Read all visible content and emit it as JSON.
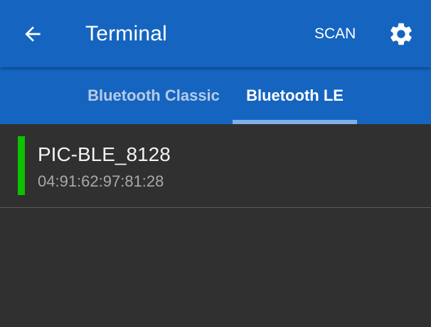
{
  "app_bar": {
    "back_icon": "arrow-back-icon",
    "title": "Terminal",
    "scan_label": "SCAN",
    "settings_icon": "gear-icon",
    "color": "#1565c0"
  },
  "tabs": [
    {
      "label": "Bluetooth Classic",
      "selected": false
    },
    {
      "label": "Bluetooth LE",
      "selected": true
    }
  ],
  "devices": [
    {
      "name": "PIC-BLE_8128",
      "address": "04:91:62:97:81:28",
      "status_color": "#0ec200"
    }
  ]
}
